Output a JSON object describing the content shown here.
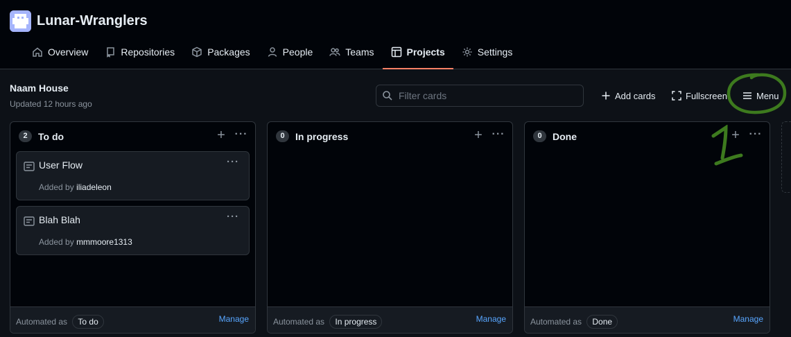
{
  "org": {
    "name": "Lunar-Wranglers"
  },
  "nav": {
    "tabs": [
      {
        "label": "Overview",
        "icon": "home-icon"
      },
      {
        "label": "Repositories",
        "icon": "repo-icon"
      },
      {
        "label": "Packages",
        "icon": "package-icon"
      },
      {
        "label": "People",
        "icon": "person-icon"
      },
      {
        "label": "Teams",
        "icon": "people-icon"
      },
      {
        "label": "Projects",
        "icon": "table-icon",
        "active": true
      },
      {
        "label": "Settings",
        "icon": "gear-icon"
      }
    ]
  },
  "project": {
    "title": "Naam House",
    "updated": "Updated 12 hours ago"
  },
  "toolbar": {
    "filter_placeholder": "Filter cards",
    "add_cards": "Add cards",
    "fullscreen": "Fullscreen",
    "menu": "Menu"
  },
  "columns": [
    {
      "name": "To do",
      "count": "2",
      "automated_label": "Automated as",
      "automated_value": "To do",
      "manage": "Manage",
      "cards": [
        {
          "title": "User Flow",
          "added_by_label": "Added by",
          "user": "iliadeleon"
        },
        {
          "title": "Blah Blah",
          "added_by_label": "Added by",
          "user": "mmmoore1313"
        }
      ]
    },
    {
      "name": "In progress",
      "count": "0",
      "automated_label": "Automated as",
      "automated_value": "In progress",
      "manage": "Manage",
      "cards": []
    },
    {
      "name": "Done",
      "count": "0",
      "automated_label": "Automated as",
      "automated_value": "Done",
      "manage": "Manage",
      "cards": []
    }
  ],
  "annotation": {
    "number": "1",
    "color": "#3d7a1e"
  },
  "colors": {
    "accent_tab": "#f78166",
    "link": "#58a6ff",
    "background": "#0d1117"
  }
}
